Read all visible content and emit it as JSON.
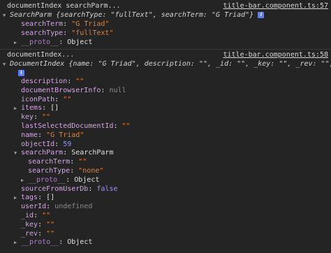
{
  "log1": {
    "message": "documentIndex searchParm...",
    "source": "title-bar.component.ts:57",
    "object_label": "SearchParm",
    "preview": "{searchType: \"fullText\", searchTerm: \"G Triad\"}",
    "info_icon": "i",
    "props": [
      {
        "key": "searchTerm",
        "value": "\"G Triad\"",
        "kind": "str"
      },
      {
        "key": "searchType",
        "value": "\"fullText\"",
        "kind": "str"
      }
    ],
    "proto_key": "__proto__",
    "proto_value": "Object"
  },
  "log2": {
    "message": "documentIndex...",
    "source": "title-bar.component.ts:58",
    "object_label": "DocumentIndex",
    "preview": "{name: \"G Triad\", description: \"\", _id: \"\", _key: \"\", _rev: \"\", …}",
    "info_icon": "i",
    "props": [
      {
        "key": "description",
        "value": "\"\"",
        "kind": "str"
      },
      {
        "key": "documentBrowserInfo",
        "value": "null",
        "kind": "null"
      },
      {
        "key": "iconPath",
        "value": "\"\"",
        "kind": "str"
      },
      {
        "key": "items",
        "value": "[]",
        "kind": "plain",
        "expandable": true
      },
      {
        "key": "key",
        "value": "\"\"",
        "kind": "str"
      },
      {
        "key": "lastSelectedDocumentId",
        "value": "\"\"",
        "kind": "str"
      },
      {
        "key": "name",
        "value": "\"G Triad\"",
        "kind": "str"
      },
      {
        "key": "objectId",
        "value": "59",
        "kind": "num"
      },
      {
        "key": "searchParm",
        "value": "SearchParm",
        "kind": "plain",
        "expandable": true,
        "expanded": true
      },
      {
        "key": "searchTerm",
        "value": "\"\"",
        "kind": "str",
        "nested": true
      },
      {
        "key": "searchType",
        "value": "\"none\"",
        "kind": "str",
        "nested": true
      },
      {
        "key": "__proto__",
        "value": "Object",
        "kind": "plain",
        "nested": true,
        "expandable": true,
        "proto": true
      },
      {
        "key": "sourceFromUserDb",
        "value": "false",
        "kind": "kw"
      },
      {
        "key": "tags",
        "value": "[]",
        "kind": "plain",
        "expandable": true
      },
      {
        "key": "userId",
        "value": "undefined",
        "kind": "null"
      },
      {
        "key": "_id",
        "value": "\"\"",
        "kind": "str"
      },
      {
        "key": "_key",
        "value": "\"\"",
        "kind": "str"
      },
      {
        "key": "_rev",
        "value": "\"\"",
        "kind": "str"
      },
      {
        "key": "__proto__",
        "value": "Object",
        "kind": "plain",
        "expandable": true,
        "proto": true
      }
    ]
  }
}
